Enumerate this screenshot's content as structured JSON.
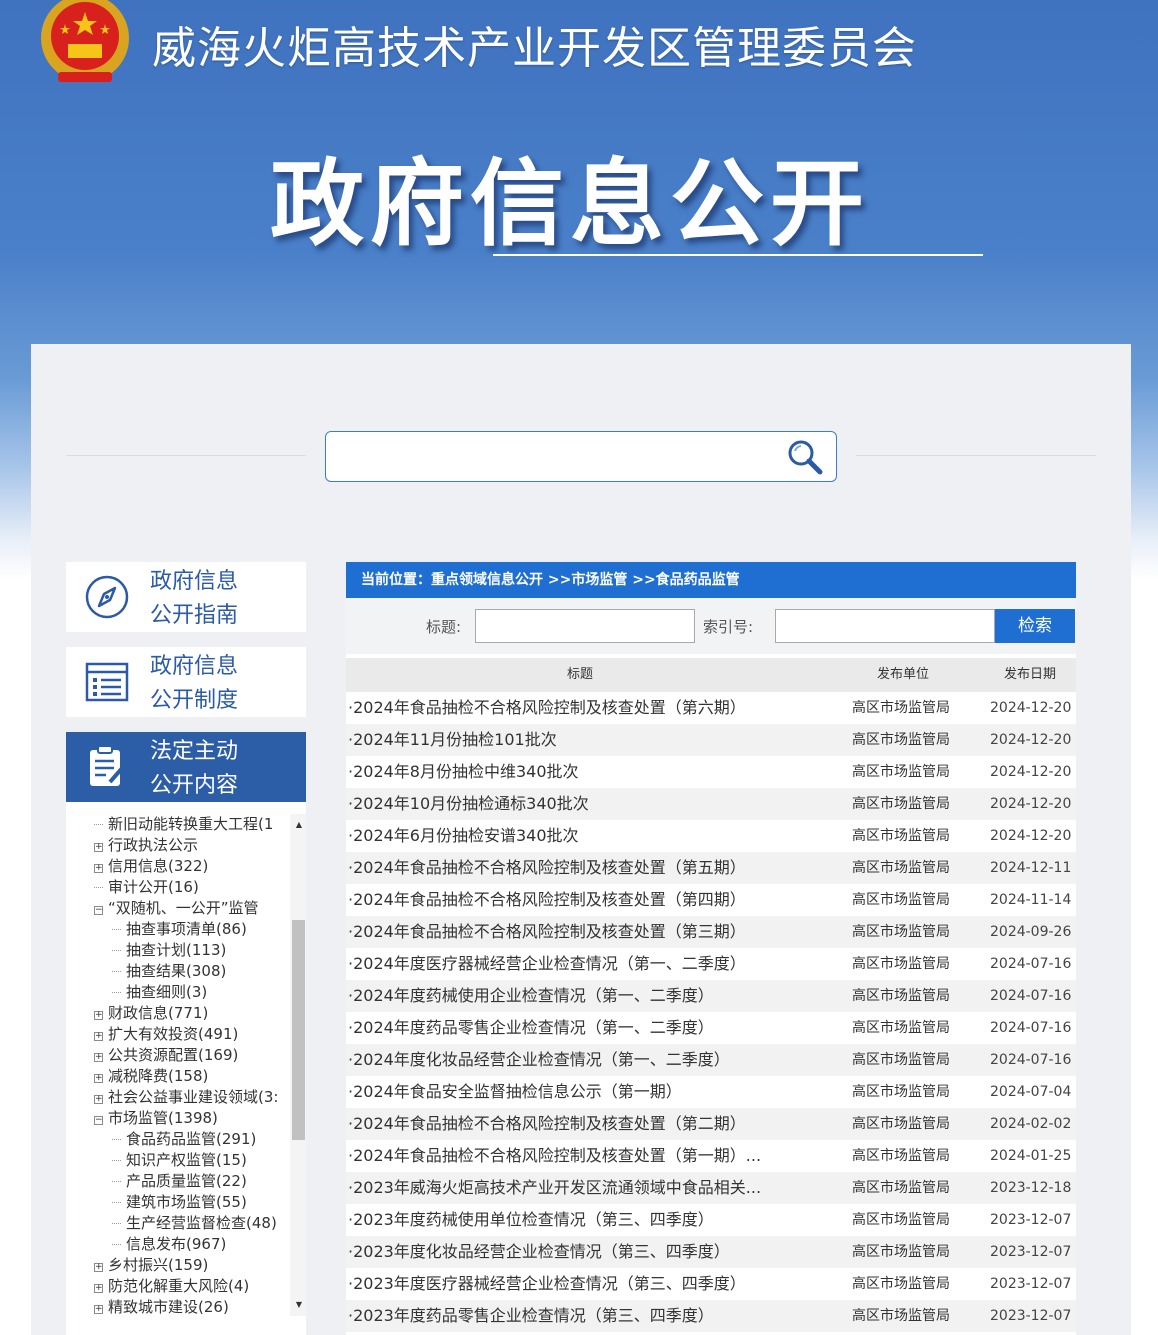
{
  "header": {
    "org_name": "威海火炬高技术产业开发区管理委员会",
    "banner_title": "政府信息公开"
  },
  "search": {
    "placeholder": ""
  },
  "nav": {
    "guide": [
      "政府信息",
      "公开指南"
    ],
    "system": [
      "政府信息",
      "公开制度"
    ],
    "active": [
      "法定主动",
      "公开内容"
    ]
  },
  "tree": [
    {
      "label": "新旧动能转换重大工程(1",
      "level": 0,
      "toggle": "line"
    },
    {
      "label": "行政执法公示",
      "level": 0,
      "toggle": "+"
    },
    {
      "label": "信用信息(322)",
      "level": 0,
      "toggle": "+"
    },
    {
      "label": "审计公开(16)",
      "level": 0,
      "toggle": "line"
    },
    {
      "label": "“双随机、一公开”监管",
      "level": 0,
      "toggle": "-"
    },
    {
      "label": "抽查事项清单(86)",
      "level": 1,
      "toggle": "line"
    },
    {
      "label": "抽查计划(113)",
      "level": 1,
      "toggle": "line"
    },
    {
      "label": "抽查结果(308)",
      "level": 1,
      "toggle": "line"
    },
    {
      "label": "抽查细则(3)",
      "level": 1,
      "toggle": "line"
    },
    {
      "label": "财政信息(771)",
      "level": 0,
      "toggle": "+"
    },
    {
      "label": "扩大有效投资(491)",
      "level": 0,
      "toggle": "+"
    },
    {
      "label": "公共资源配置(169)",
      "level": 0,
      "toggle": "+"
    },
    {
      "label": "减税降费(158)",
      "level": 0,
      "toggle": "+"
    },
    {
      "label": "社会公益事业建设领域(3:",
      "level": 0,
      "toggle": "+"
    },
    {
      "label": "市场监管(1398)",
      "level": 0,
      "toggle": "-"
    },
    {
      "label": "食品药品监管(291)",
      "level": 1,
      "toggle": "line"
    },
    {
      "label": "知识产权监管(15)",
      "level": 1,
      "toggle": "line"
    },
    {
      "label": "产品质量监管(22)",
      "level": 1,
      "toggle": "line"
    },
    {
      "label": "建筑市场监管(55)",
      "level": 1,
      "toggle": "line"
    },
    {
      "label": "生产经营监督检查(48)",
      "level": 1,
      "toggle": "line"
    },
    {
      "label": "信息发布(967)",
      "level": 1,
      "toggle": "line"
    },
    {
      "label": "乡村振兴(159)",
      "level": 0,
      "toggle": "+"
    },
    {
      "label": "防范化解重大风险(4)",
      "level": 0,
      "toggle": "+"
    },
    {
      "label": "精致城市建设(26)",
      "level": 0,
      "toggle": "+"
    }
  ],
  "content": {
    "breadcrumb": "当前位置：重点领域信息公开 >>市场监管 >>食品药品监管",
    "filter": {
      "title_label": "标题:",
      "index_label": "索引号:",
      "button": "检索"
    },
    "columns": {
      "title": "标题",
      "unit": "发布单位",
      "date": "发布日期"
    },
    "rows": [
      {
        "title": "·2024年食品抽检不合格风险控制及核查处置（第六期）",
        "unit": "高区市场监管局",
        "date": "2024-12-20"
      },
      {
        "title": "·2024年11月份抽检101批次",
        "unit": "高区市场监管局",
        "date": "2024-12-20"
      },
      {
        "title": "·2024年8月份抽检中维340批次",
        "unit": "高区市场监管局",
        "date": "2024-12-20"
      },
      {
        "title": "·2024年10月份抽检通标340批次",
        "unit": "高区市场监管局",
        "date": "2024-12-20"
      },
      {
        "title": "·2024年6月份抽检安谱340批次",
        "unit": "高区市场监管局",
        "date": "2024-12-20"
      },
      {
        "title": "·2024年食品抽检不合格风险控制及核查处置（第五期）",
        "unit": "高区市场监管局",
        "date": "2024-12-11"
      },
      {
        "title": "·2024年食品抽检不合格风险控制及核查处置（第四期）",
        "unit": "高区市场监管局",
        "date": "2024-11-14"
      },
      {
        "title": "·2024年食品抽检不合格风险控制及核查处置（第三期）",
        "unit": "高区市场监管局",
        "date": "2024-09-26"
      },
      {
        "title": "·2024年度医疗器械经营企业检查情况（第一、二季度）",
        "unit": "高区市场监管局",
        "date": "2024-07-16"
      },
      {
        "title": "·2024年度药械使用企业检查情况（第一、二季度）",
        "unit": "高区市场监管局",
        "date": "2024-07-16"
      },
      {
        "title": "·2024年度药品零售企业检查情况（第一、二季度）",
        "unit": "高区市场监管局",
        "date": "2024-07-16"
      },
      {
        "title": "·2024年度化妆品经营企业检查情况（第一、二季度）",
        "unit": "高区市场监管局",
        "date": "2024-07-16"
      },
      {
        "title": "·2024年食品安全监督抽检信息公示（第一期）",
        "unit": "高区市场监管局",
        "date": "2024-07-04"
      },
      {
        "title": "·2024年食品抽检不合格风险控制及核查处置（第二期）",
        "unit": "高区市场监管局",
        "date": "2024-02-02"
      },
      {
        "title": "·2024年食品抽检不合格风险控制及核查处置（第一期）...",
        "unit": "高区市场监管局",
        "date": "2024-01-25"
      },
      {
        "title": "·2023年威海火炬高技术产业开发区流通领域中食品相关...",
        "unit": "高区市场监管局",
        "date": "2023-12-18"
      },
      {
        "title": "·2023年度药械使用单位检查情况（第三、四季度）",
        "unit": "高区市场监管局",
        "date": "2023-12-07"
      },
      {
        "title": "·2023年度化妆品经营企业检查情况（第三、四季度）",
        "unit": "高区市场监管局",
        "date": "2023-12-07"
      },
      {
        "title": "·2023年度医疗器械经营企业检查情况（第三、四季度）",
        "unit": "高区市场监管局",
        "date": "2023-12-07"
      },
      {
        "title": "·2023年度药品零售企业检查情况（第三、四季度）",
        "unit": "高区市场监管局",
        "date": "2023-12-07"
      }
    ]
  },
  "colors": {
    "primary": "#1f6fd3",
    "nav_active": "#2c5ea8",
    "nav_text": "#2b5aa7"
  },
  "icons": [
    "national-emblem",
    "search-icon",
    "compass-icon",
    "list-icon",
    "document-edit-icon"
  ]
}
